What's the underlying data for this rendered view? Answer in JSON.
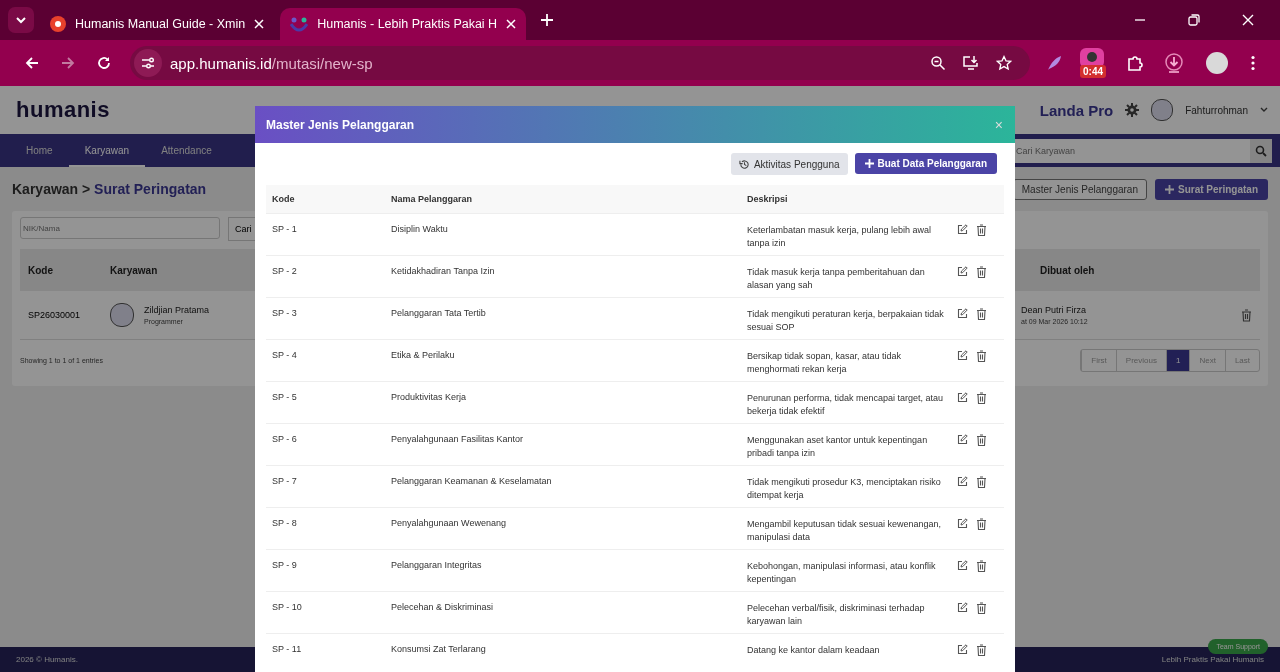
{
  "browser": {
    "tabs": [
      {
        "title": "Humanis Manual Guide - Xmin",
        "selected": false
      },
      {
        "title": "Humanis - Lebih Praktis Pakai H",
        "selected": true
      }
    ],
    "address": {
      "host": "app.humanis.id",
      "path": "/mutasi/new-sp"
    },
    "extension_badge": "0:44"
  },
  "header": {
    "logo": "humanis",
    "company": "Landa Pro",
    "user": "Fahturrohman"
  },
  "nav": {
    "items": [
      {
        "label": "Home",
        "selected": false
      },
      {
        "label": "Karyawan",
        "selected": true
      },
      {
        "label": "Attendance",
        "selected": false
      }
    ],
    "search_placeholder": "Cari Karyawan"
  },
  "breadcrumb": {
    "parent": "Karyawan",
    "separator": ">",
    "current": "Surat Peringatan"
  },
  "page_buttons": [
    "Master Jenis Pelanggaran",
    "Surat Peringatan"
  ],
  "filter": {
    "placeholder": "NIK/Nama",
    "button": "Cari"
  },
  "table": {
    "columns": [
      "Kode",
      "Karyawan",
      "Dibuat oleh"
    ],
    "rows": [
      {
        "kode": "SP26030001",
        "name": "Zildjian Pratama",
        "role": "Programmer",
        "created_by": "Dean Putri Firza",
        "created_at": "at 09 Mar 2026 10:12"
      }
    ]
  },
  "entries": "Showing 1 to 1 of 1 entries",
  "pagination": [
    {
      "label": "First",
      "selected": false
    },
    {
      "label": "Previous",
      "selected": false
    },
    {
      "label": "1",
      "selected": true
    },
    {
      "label": "Next",
      "selected": false
    },
    {
      "label": "Last",
      "selected": false
    }
  ],
  "footer": {
    "left": "2026 © Humanis.",
    "right": "Lebih Praktis Pakai Humanis",
    "support": "Team Support"
  },
  "modal": {
    "title": "Master Jenis Pelanggaran",
    "close": "×",
    "buttons": [
      "Aktivitas Pengguna",
      "Buat Data Pelanggaran"
    ],
    "columns": [
      "Kode",
      "Nama Pelanggaran",
      "Deskripsi"
    ],
    "rows": [
      {
        "kode": "SP - 1",
        "nama": "Disiplin Waktu",
        "deskripsi": "Keterlambatan masuk kerja, pulang lebih awal tanpa izin"
      },
      {
        "kode": "SP - 2",
        "nama": "Ketidakhadiran Tanpa Izin",
        "deskripsi": "Tidak masuk kerja tanpa pemberitahuan dan alasan yang sah"
      },
      {
        "kode": "SP - 3",
        "nama": "Pelanggaran Tata Tertib",
        "deskripsi": "Tidak mengikuti peraturan kerja, berpakaian tidak sesuai SOP"
      },
      {
        "kode": "SP - 4",
        "nama": "Etika & Perilaku",
        "deskripsi": "Bersikap tidak sopan, kasar, atau tidak menghormati rekan kerja"
      },
      {
        "kode": "SP - 5",
        "nama": "Produktivitas Kerja",
        "deskripsi": "Penurunan performa, tidak mencapai target, atau bekerja tidak efektif"
      },
      {
        "kode": "SP - 6",
        "nama": "Penyalahgunaan Fasilitas Kantor",
        "deskripsi": "Menggunakan aset kantor untuk kepentingan pribadi tanpa izin"
      },
      {
        "kode": "SP - 7",
        "nama": "Pelanggaran Keamanan & Keselamatan",
        "deskripsi": "Tidak mengikuti prosedur K3, menciptakan risiko ditempat kerja"
      },
      {
        "kode": "SP - 8",
        "nama": "Penyalahgunaan Wewenang",
        "deskripsi": "Mengambil keputusan tidak sesuai kewenangan, manipulasi data"
      },
      {
        "kode": "SP - 9",
        "nama": "Pelanggaran Integritas",
        "deskripsi": "Kebohongan, manipulasi informasi, atau konflik kepentingan"
      },
      {
        "kode": "SP - 10",
        "nama": "Pelecehan & Diskriminasi",
        "deskripsi": "Pelecehan verbal/fisik, diskriminasi terhadap karyawan lain"
      },
      {
        "kode": "SP - 11",
        "nama": "Konsumsi Zat Terlarang",
        "deskripsi": "Datang ke kantor dalam keadaan"
      }
    ]
  }
}
